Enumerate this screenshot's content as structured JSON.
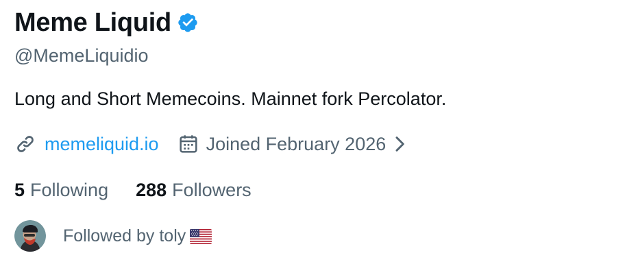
{
  "profile": {
    "display_name": "Meme Liquid",
    "verified": true,
    "verified_badge_icon": "verified-badge-icon",
    "handle": "@MemeLiquidio",
    "bio": "Long and Short Memecoins. Mainnet fork Percolator.",
    "website": {
      "icon": "link-icon",
      "label": "memeliquid.io"
    },
    "joined": {
      "icon": "calendar-icon",
      "label": "Joined February 2026",
      "chevron_icon": "chevron-right-icon"
    },
    "stats": {
      "following_count": "5",
      "following_label": "Following",
      "followers_count": "288",
      "followers_label": "Followers"
    },
    "followed_by": {
      "avatar_icon": "avatar",
      "text": "Followed by toly",
      "flag_icon": "us-flag-icon"
    }
  },
  "colors": {
    "text_primary": "#0f1419",
    "text_secondary": "#536471",
    "link": "#1d9bf0",
    "verified": "#1d9bf0",
    "background": "#ffffff"
  }
}
